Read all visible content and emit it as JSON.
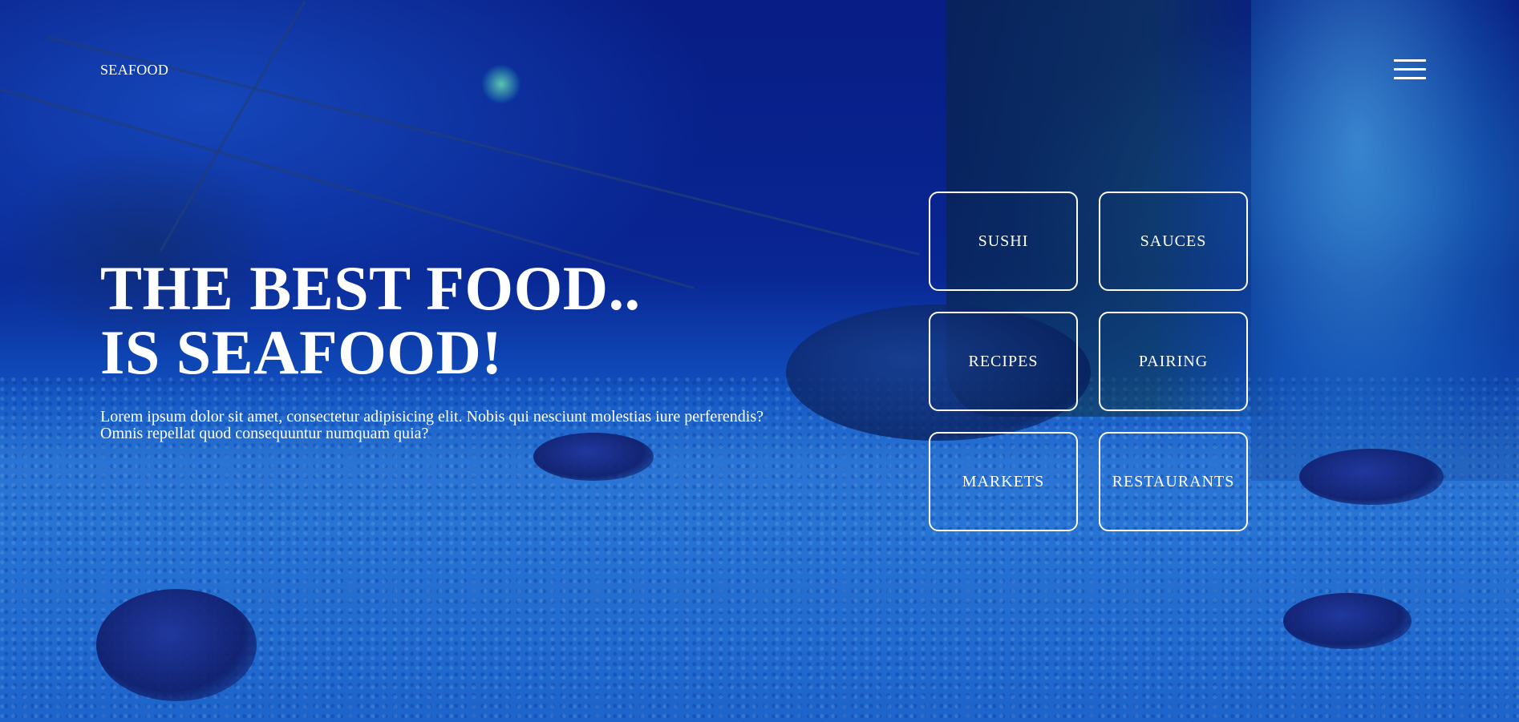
{
  "header": {
    "brand": "SEAFOOD",
    "menu_icon": "hamburger-menu-icon"
  },
  "hero": {
    "title_line1": "THE BEST FOOD..",
    "title_line2": "IS SEAFOOD!",
    "text": "Lorem ipsum dolor sit amet, consectetur adipisicing elit. Nobis qui nesciunt molestias iure perferendis? Omnis repellat quod consequuntur numquam quia?"
  },
  "categories": [
    {
      "label": "SUSHI"
    },
    {
      "label": "SAUCES"
    },
    {
      "label": "RECIPES"
    },
    {
      "label": "PAIRING"
    },
    {
      "label": "MARKETS"
    },
    {
      "label": "RESTAURANTS"
    }
  ],
  "colors": {
    "text": "#ffffff",
    "background_tint": "#1560d8"
  }
}
